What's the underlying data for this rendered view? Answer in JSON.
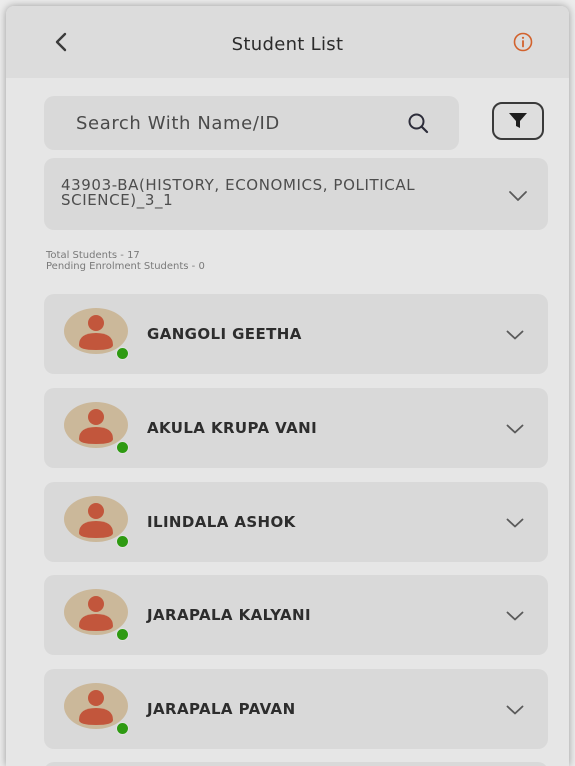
{
  "header": {
    "title": "Student List",
    "back_icon": "chevron-left-icon",
    "info_icon": "info-icon",
    "info_color": "#d2622d"
  },
  "search": {
    "placeholder": "Search With Name/ID",
    "icon": "search-icon"
  },
  "filter": {
    "icon": "filter-icon"
  },
  "course": {
    "selected": "43903-BA(HISTORY, ECONOMICS, POLITICAL SCIENCE)_3_1"
  },
  "summary": {
    "total_students": "Total Students - 17",
    "pending_enrolment": "Pending Enrolment Students - 0"
  },
  "students": [
    {
      "name": "GANGOLI GEETHA"
    },
    {
      "name": "AKULA KRUPA VANI"
    },
    {
      "name": "ILINDALA ASHOK"
    },
    {
      "name": "JARAPALA KALYANI"
    },
    {
      "name": "JARAPALA PAVAN"
    }
  ],
  "colors": {
    "avatar_bg": "#cbb89a",
    "avatar_person": "#c2563c",
    "status_online": "#2e9a12"
  }
}
